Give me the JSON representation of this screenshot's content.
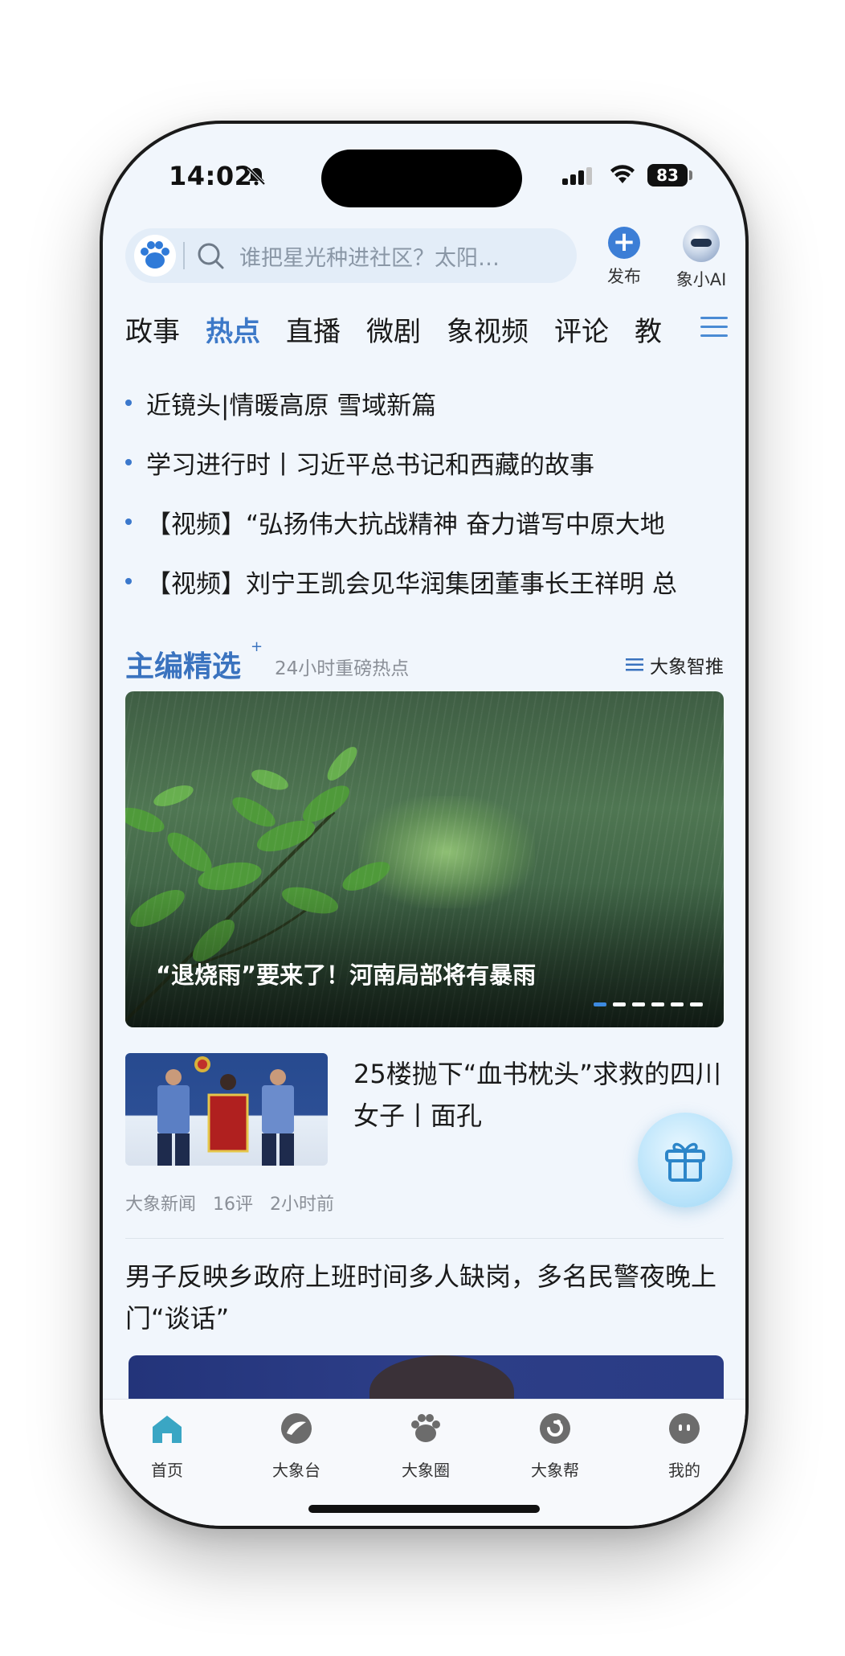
{
  "status_bar": {
    "time": "14:02",
    "battery": "83"
  },
  "search": {
    "placeholder": "谁把星光种进社区？太阳…"
  },
  "header_actions": {
    "publish_label": "发布",
    "ai_label": "象小AI"
  },
  "tabs": [
    {
      "label": "政事",
      "active": false
    },
    {
      "label": "热点",
      "active": true
    },
    {
      "label": "直播",
      "active": false
    },
    {
      "label": "微剧",
      "active": false
    },
    {
      "label": "象视频",
      "active": false
    },
    {
      "label": "评论",
      "active": false
    },
    {
      "label": "教",
      "active": false
    }
  ],
  "headlines": [
    "近镜头|情暖高原  雪域新篇",
    "学习进行时丨习近平总书记和西藏的故事",
    "【视频】“弘扬伟大抗战精神  奋力谱写中原大地",
    "【视频】刘宁王凯会见华润集团董事长王祥明  总"
  ],
  "editor_pick": {
    "title": "主编精选",
    "plus": "+",
    "subtitle": "24小时重磅热点",
    "smart_push": "大象智推"
  },
  "hero": {
    "caption": "“退烧雨”要来了！河南局部将有暴雨",
    "dots": 6,
    "active_dot": 0
  },
  "news_items": [
    {
      "title": "25楼抛下“血书枕头”求救的四川女子丨面孔",
      "source": "大象新闻",
      "comments": "16评",
      "time": "2小时前"
    },
    {
      "title": "男子反映乡政府上班时间多人缺岗，多名民警夜晚上门“谈话”"
    }
  ],
  "bottom_nav": [
    {
      "label": "首页",
      "icon": "home-icon",
      "active": true
    },
    {
      "label": "大象台",
      "icon": "tv-station-icon",
      "active": false
    },
    {
      "label": "大象圈",
      "icon": "paw-icon",
      "active": false
    },
    {
      "label": "大象帮",
      "icon": "help-icon",
      "active": false
    },
    {
      "label": "我的",
      "icon": "profile-icon",
      "active": false
    }
  ],
  "colors": {
    "accent": "#3d79c8",
    "background": "#f1f6fc",
    "nav_active": "#3aa6c4"
  }
}
